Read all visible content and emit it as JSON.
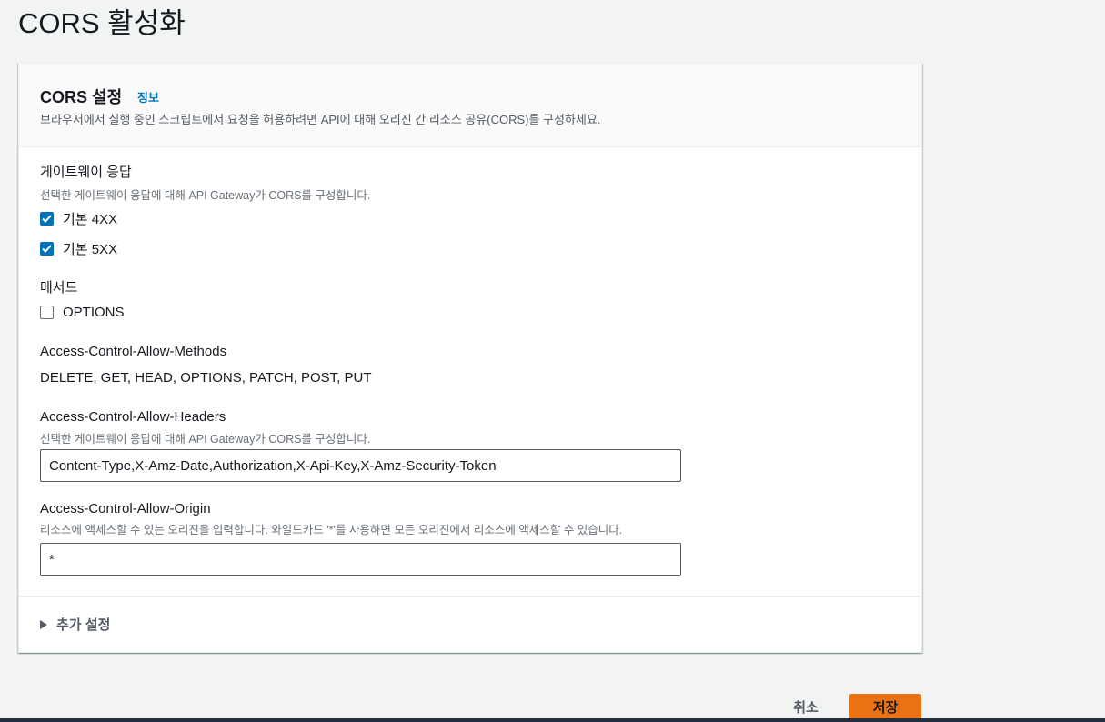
{
  "page": {
    "title": "CORS 활성화"
  },
  "panel": {
    "title": "CORS 설정",
    "info_link": "정보",
    "description": "브라우저에서 실행 중인 스크립트에서 요청을 허용하려면 API에 대해 오리진 간 리소스 공유(CORS)를 구성하세요."
  },
  "gateway_responses": {
    "label": "게이트웨이 응답",
    "description": "선택한 게이트웨이 응답에 대해 API Gateway가 CORS를 구성합니다.",
    "options": [
      {
        "label": "기본 4XX",
        "checked": true
      },
      {
        "label": "기본 5XX",
        "checked": true
      }
    ]
  },
  "methods": {
    "label": "메서드",
    "options": [
      {
        "label": "OPTIONS",
        "checked": false
      }
    ]
  },
  "allow_methods": {
    "label": "Access-Control-Allow-Methods",
    "value": "DELETE, GET, HEAD, OPTIONS, PATCH, POST, PUT"
  },
  "allow_headers": {
    "label": "Access-Control-Allow-Headers",
    "description": "선택한 게이트웨이 응답에 대해 API Gateway가 CORS를 구성합니다.",
    "value": "Content-Type,X-Amz-Date,Authorization,X-Api-Key,X-Amz-Security-Token"
  },
  "allow_origin": {
    "label": "Access-Control-Allow-Origin",
    "description": "리소스에 액세스할 수 있는 오리진을 입력합니다. 와일드카드 '*'를 사용하면 모든 오리진에서 리소스에 액세스할 수 있습니다.",
    "value": "*"
  },
  "additional_settings": {
    "label": "추가 설정",
    "icon": "caret-right-icon",
    "expanded": false
  },
  "actions": {
    "cancel_label": "취소",
    "save_label": "저장"
  },
  "colors": {
    "primary": "#ec7211",
    "link": "#0073bb",
    "checkbox": "#0073bb"
  }
}
